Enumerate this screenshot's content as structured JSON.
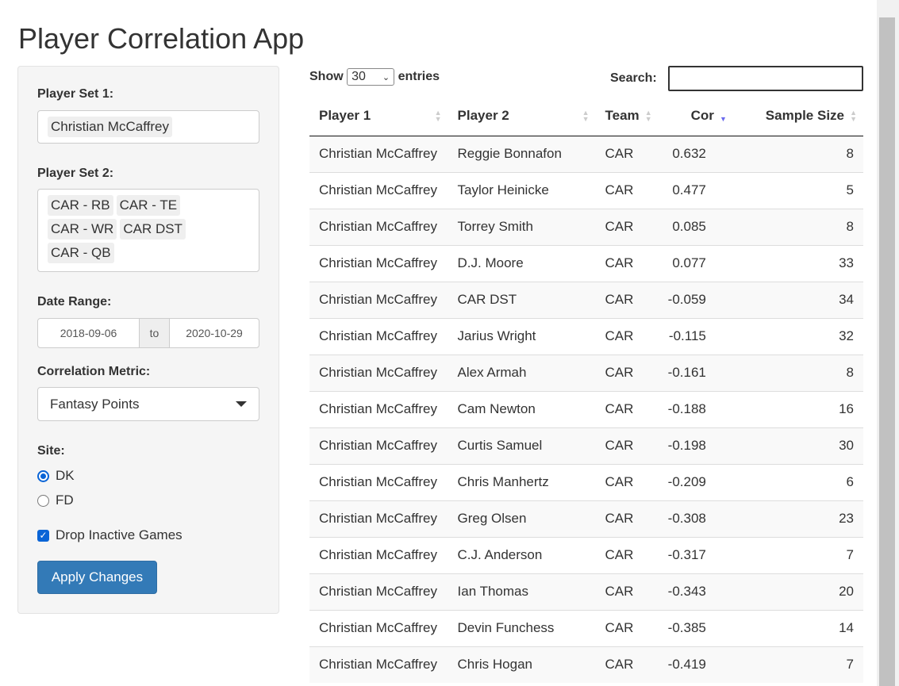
{
  "title": "Player Correlation App",
  "sidebar": {
    "player_set_1_label": "Player Set 1:",
    "player_set_1": [
      "Christian McCaffrey"
    ],
    "player_set_2_label": "Player Set 2:",
    "player_set_2": [
      "CAR - RB",
      "CAR - TE",
      "CAR - WR",
      "CAR DST",
      "CAR - QB"
    ],
    "date_range_label": "Date Range:",
    "date_start": "2018-09-06",
    "date_sep": "to",
    "date_end": "2020-10-29",
    "metric_label": "Correlation Metric:",
    "metric_value": "Fantasy Points",
    "site_label": "Site:",
    "site_options": [
      "DK",
      "FD"
    ],
    "site_selected": "DK",
    "drop_inactive_label": "Drop Inactive Games",
    "drop_inactive_checked": true,
    "apply_label": "Apply Changes"
  },
  "table": {
    "show_label": "Show",
    "entries_value": "30",
    "entries_label": "entries",
    "search_label": "Search:",
    "search_value": "",
    "columns": [
      "Player 1",
      "Player 2",
      "Team",
      "Cor",
      "Sample Size"
    ],
    "sorted_column": "Cor",
    "sort_direction": "desc",
    "rows": [
      [
        "Christian McCaffrey",
        "Reggie Bonnafon",
        "CAR",
        "0.632",
        "8"
      ],
      [
        "Christian McCaffrey",
        "Taylor Heinicke",
        "CAR",
        "0.477",
        "5"
      ],
      [
        "Christian McCaffrey",
        "Torrey Smith",
        "CAR",
        "0.085",
        "8"
      ],
      [
        "Christian McCaffrey",
        "D.J. Moore",
        "CAR",
        "0.077",
        "33"
      ],
      [
        "Christian McCaffrey",
        "CAR DST",
        "CAR",
        "-0.059",
        "34"
      ],
      [
        "Christian McCaffrey",
        "Jarius Wright",
        "CAR",
        "-0.115",
        "32"
      ],
      [
        "Christian McCaffrey",
        "Alex Armah",
        "CAR",
        "-0.161",
        "8"
      ],
      [
        "Christian McCaffrey",
        "Cam Newton",
        "CAR",
        "-0.188",
        "16"
      ],
      [
        "Christian McCaffrey",
        "Curtis Samuel",
        "CAR",
        "-0.198",
        "30"
      ],
      [
        "Christian McCaffrey",
        "Chris Manhertz",
        "CAR",
        "-0.209",
        "6"
      ],
      [
        "Christian McCaffrey",
        "Greg Olsen",
        "CAR",
        "-0.308",
        "23"
      ],
      [
        "Christian McCaffrey",
        "C.J. Anderson",
        "CAR",
        "-0.317",
        "7"
      ],
      [
        "Christian McCaffrey",
        "Ian Thomas",
        "CAR",
        "-0.343",
        "20"
      ],
      [
        "Christian McCaffrey",
        "Devin Funchess",
        "CAR",
        "-0.385",
        "14"
      ],
      [
        "Christian McCaffrey",
        "Chris Hogan",
        "CAR",
        "-0.419",
        "7"
      ]
    ]
  },
  "colors": {
    "primary_button": "#337ab7",
    "sort_active": "#6a6aee",
    "panel_bg": "#f5f5f5"
  }
}
